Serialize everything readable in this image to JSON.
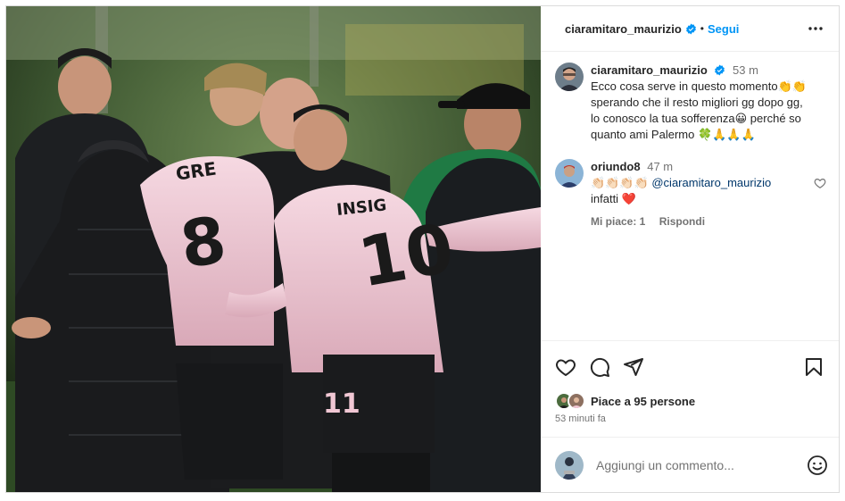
{
  "post": {
    "author": "ciaramitaro_maurizio",
    "follow_label": "Segui",
    "separator": "•",
    "caption": {
      "user": "ciaramitaro_maurizio",
      "time": "53 m",
      "lines": [
        "Ecco cosa serve in questo momento👏👏",
        "sperando che il resto migliori gg dopo gg,",
        "lo conosco la tua sofferenza😀 perché so",
        "quanto ami Palermo 🍀🙏🙏🙏"
      ]
    },
    "comments": [
      {
        "user": "oriundo8",
        "time": "47 m",
        "text_prefix": "👏🏻👏🏻👏🏻👏🏻 ",
        "mention": "@ciaramitaro_maurizio",
        "text_line2": "infatti ❤️",
        "likes_label": "Mi piace: 1",
        "reply_label": "Rispondi"
      }
    ],
    "likes_text": "Piace a 95 persone",
    "time_ago": "53 minuti fa",
    "add_comment_placeholder": "Aggiungi un commento...",
    "jersey_numbers": [
      "8",
      "10",
      "11"
    ],
    "jersey_names": [
      "GRE",
      "INSIG"
    ],
    "icons": [
      "verified-badge-icon",
      "more-options-icon",
      "heart-icon",
      "comment-icon",
      "share-icon",
      "bookmark-icon",
      "emoji-icon"
    ],
    "colors": {
      "accent": "#0095f6",
      "heart": "#ed4956",
      "pink_kit": "#f1c7d4"
    }
  }
}
